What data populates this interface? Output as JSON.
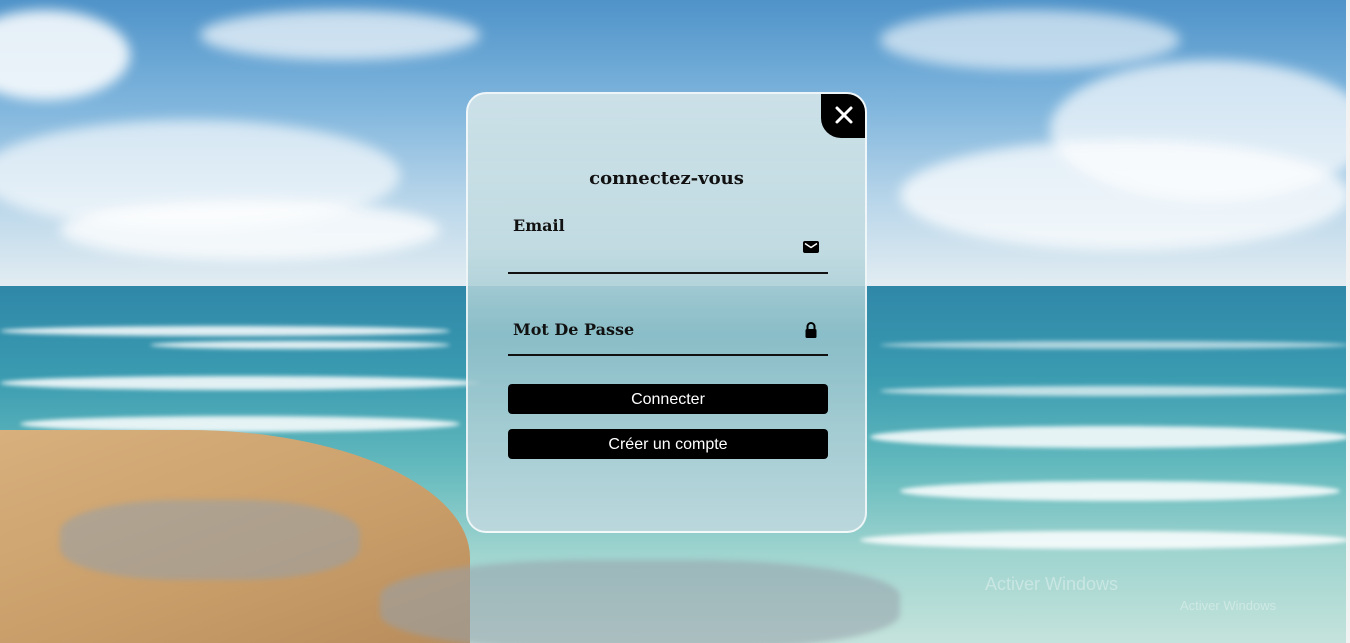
{
  "login": {
    "title": "connectez-vous",
    "email_label": "Email",
    "email_value": "",
    "password_label": "Mot De Passe",
    "password_value": "",
    "login_button": "Connecter",
    "register_button": "Créer un compte"
  },
  "icons": {
    "close": "close-icon",
    "email": "mail-icon",
    "password": "lock-icon"
  },
  "watermark": {
    "line1": "Activer Windows",
    "line2": "Activer Windows"
  },
  "colors": {
    "button_bg": "#000000",
    "button_text": "#ffffff",
    "card_border": "#ffffff"
  }
}
